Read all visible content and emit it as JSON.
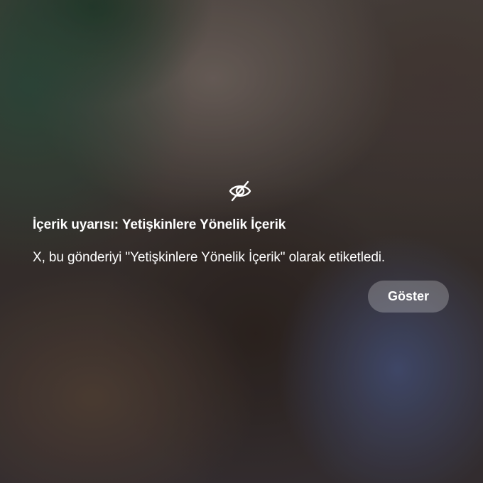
{
  "warning": {
    "icon": "eye-slash-icon",
    "title": "İçerik uyarısı: Yetişkinlere Yönelik İçerik",
    "description": "X, bu gönderiyi \"Yetişkinlere Yönelik İçerik\" olarak etiketledi.",
    "show_button_label": "Göster"
  },
  "colors": {
    "text": "#ffffff",
    "button_background": "rgba(255,255,255,0.24)"
  }
}
